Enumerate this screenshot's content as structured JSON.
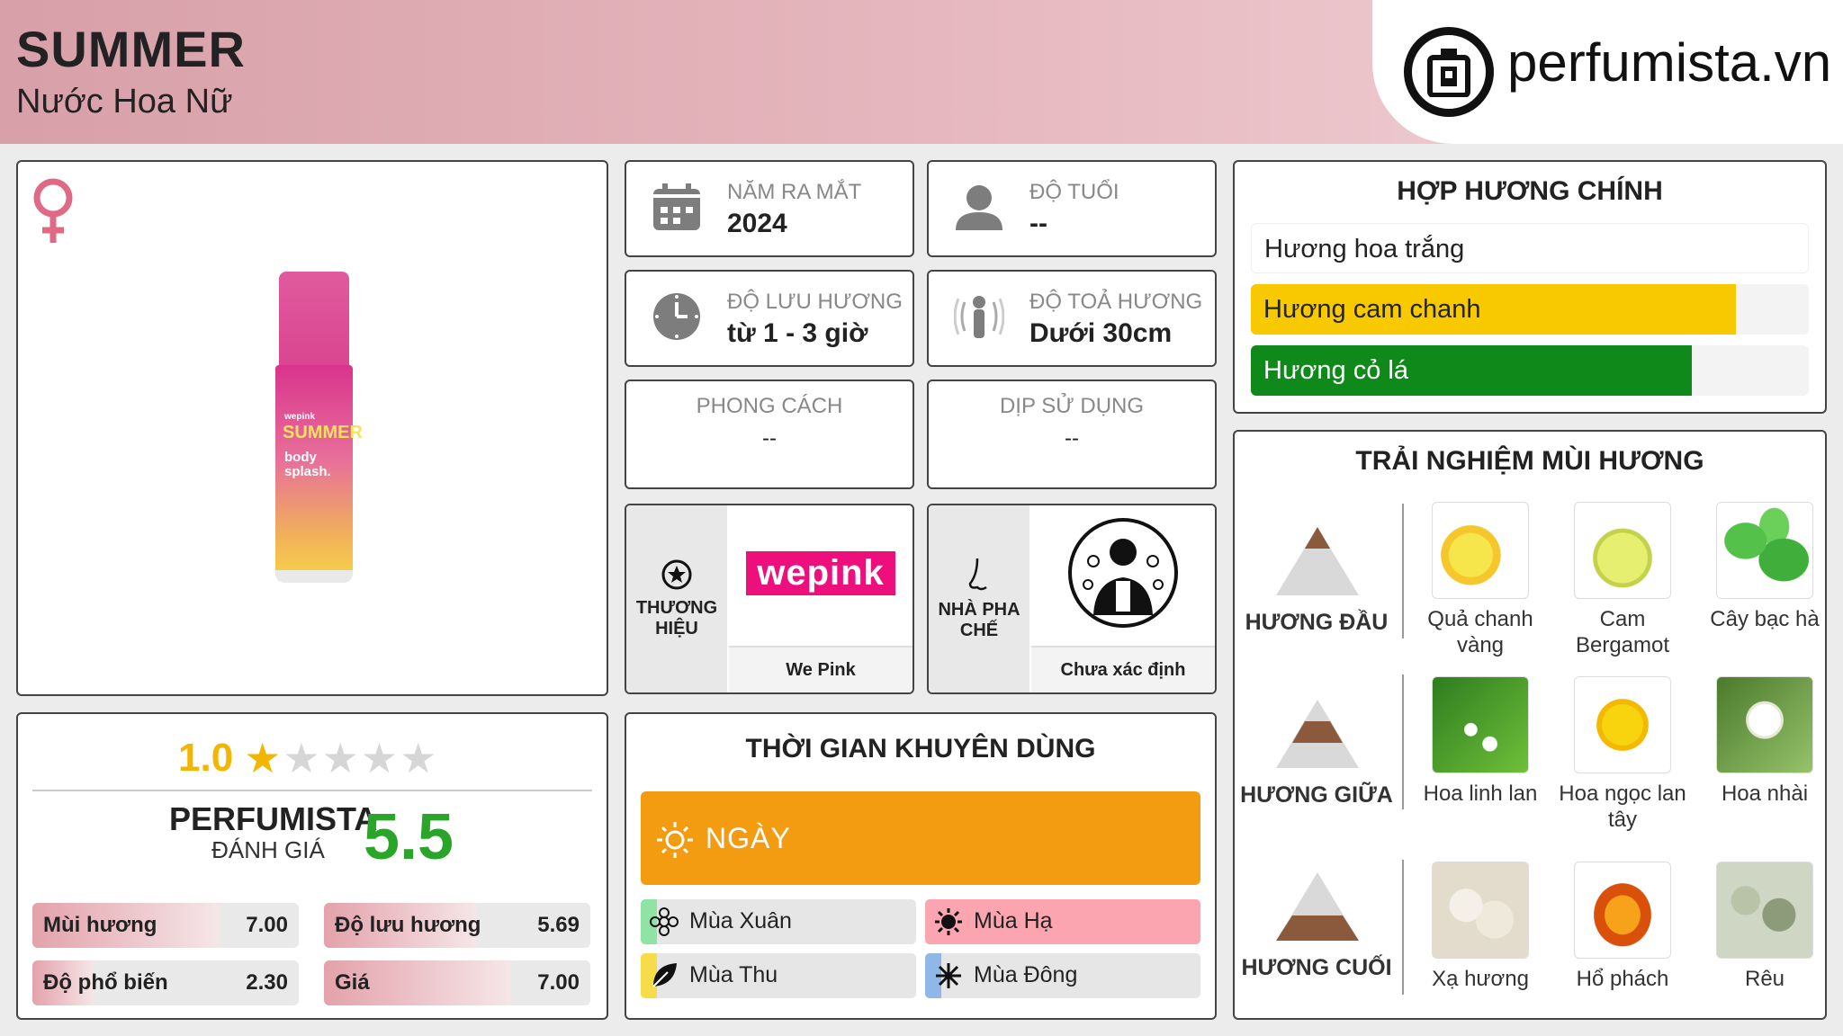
{
  "header": {
    "title": "SUMMER",
    "subtitle": "Nước Hoa Nữ",
    "logo_text": "perfumista.vn"
  },
  "product": {
    "bottle_brand": "wepink",
    "bottle_name": "SUMMER",
    "bottle_sub1": "body",
    "bottle_sub2": "splash."
  },
  "info": {
    "launch": {
      "label": "NĂM RA MẮT",
      "value": "2024"
    },
    "age": {
      "label": "ĐỘ TUỔI",
      "value": "--"
    },
    "longevity": {
      "label": "ĐỘ LƯU HƯƠNG",
      "value": "từ 1 - 3 giờ"
    },
    "sillage": {
      "label": "ĐỘ TOẢ HƯƠNG",
      "value": "Dưới 30cm"
    },
    "style": {
      "label": "PHONG CÁCH",
      "value": "--"
    },
    "occasion": {
      "label": "DỊP SỬ DỤNG",
      "value": "--"
    },
    "brand": {
      "label1": "THƯƠNG",
      "label2": "HIỆU",
      "logo": "wepink",
      "name": "We Pink"
    },
    "perfumer": {
      "label1": "NHÀ PHA",
      "label2": "CHẾ",
      "name": "Chưa xác định"
    }
  },
  "accords": {
    "title": "HỢP HƯƠNG CHÍNH",
    "items": [
      {
        "name": "Hương hoa trắng",
        "level": 1.0,
        "color": "#ffffff"
      },
      {
        "name": "Hương cam chanh",
        "level": 0.87,
        "color": "#f9c900"
      },
      {
        "name": "Hương cỏ lá",
        "level": 0.79,
        "color": "#0f8a1a"
      }
    ]
  },
  "notes": {
    "title": "TRẢI NGHIỆM MÙI HƯƠNG",
    "tiers": [
      {
        "label": "HƯƠNG ĐẦU",
        "items": [
          "Quả chanh vàng",
          "Cam Bergamot",
          "Cây bạc hà"
        ]
      },
      {
        "label": "HƯƠNG GIỮA",
        "items": [
          "Hoa linh lan",
          "Hoa ngọc lan tây",
          "Hoa nhài"
        ]
      },
      {
        "label": "HƯƠNG CUỐI",
        "items": [
          "Xạ hương",
          "Hổ phách",
          "Rêu"
        ]
      }
    ]
  },
  "rating": {
    "stars_value": "1.0",
    "stars": 1,
    "brand": "PERFUMISTA",
    "brand_sub": "ĐÁNH GIÁ",
    "score": "5.5",
    "bars": [
      {
        "name": "Mùi hương",
        "value": "7.00",
        "level": 0.7
      },
      {
        "name": "Độ lưu hương",
        "value": "5.69",
        "level": 0.57
      },
      {
        "name": "Độ phổ biến",
        "value": "2.30",
        "level": 0.23
      },
      {
        "name": "Giá",
        "value": "7.00",
        "level": 0.7
      }
    ]
  },
  "usage": {
    "title": "THỜI GIAN KHUYÊN DÙNG",
    "day": "NGÀY",
    "seasons": [
      {
        "name": "Mùa Xuân",
        "level": 0.06,
        "color": "#8fe3a4"
      },
      {
        "name": "Mùa Hạ",
        "level": 1.0,
        "color": "#fba5b0"
      },
      {
        "name": "Mùa Thu",
        "level": 0.06,
        "color": "#f7dc4a"
      },
      {
        "name": "Mùa Đông",
        "level": 0.06,
        "color": "#8fb8e8"
      }
    ]
  },
  "colors": {
    "accent_pink": "#e06a86",
    "orange": "#f39c11",
    "green_score": "#2aa52a",
    "star": "#f3b600"
  },
  "icons": [
    "female-icon",
    "calendar-icon",
    "user-icon",
    "clock-icon",
    "sillage-icon",
    "star-circle-icon",
    "nose-icon",
    "sun-icon",
    "flower-icon",
    "leaf-icon",
    "snowflake-icon"
  ]
}
